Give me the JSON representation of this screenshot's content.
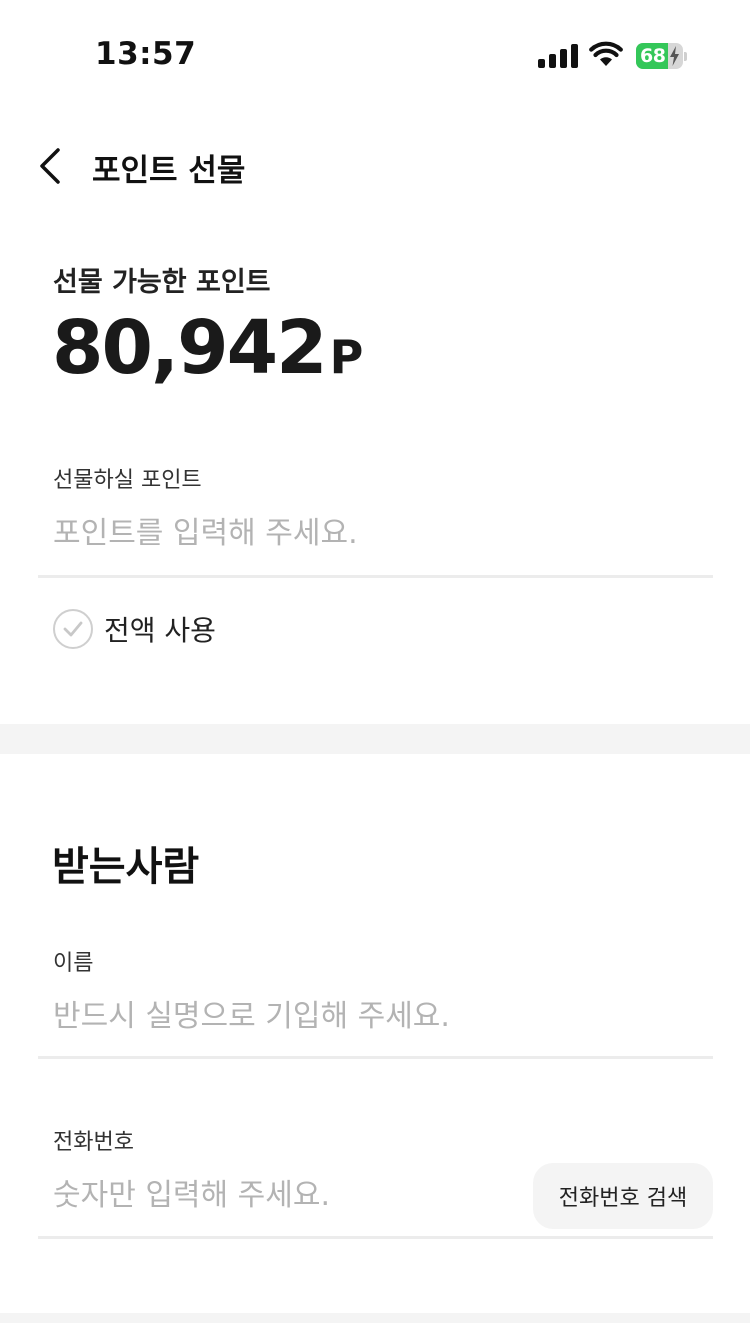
{
  "status_bar": {
    "time": "13:57",
    "battery_percent": "68",
    "battery_level": 0.68,
    "battery_color": "#34c759",
    "icons": [
      "signal-icon",
      "wifi-icon",
      "battery-icon"
    ]
  },
  "header": {
    "title": "포인트 선물",
    "back_icon": "chevron-left-icon"
  },
  "points": {
    "available_label": "선물 가능한 포인트",
    "value": "80,942",
    "unit": "P"
  },
  "gift_field": {
    "label": "선물하실 포인트",
    "placeholder": "포인트를 입력해 주세요.",
    "value": ""
  },
  "use_all": {
    "label": "전액 사용",
    "checked": false,
    "icon": "check-circle-icon"
  },
  "recipient": {
    "title": "받는사람",
    "name_label": "이름",
    "name_placeholder": "반드시 실명으로 기입해 주세요.",
    "name_value": "",
    "phone_label": "전화번호",
    "phone_placeholder": "숫자만 입력해 주세요.",
    "phone_value": "",
    "phone_search_label": "전화번호 검색"
  }
}
